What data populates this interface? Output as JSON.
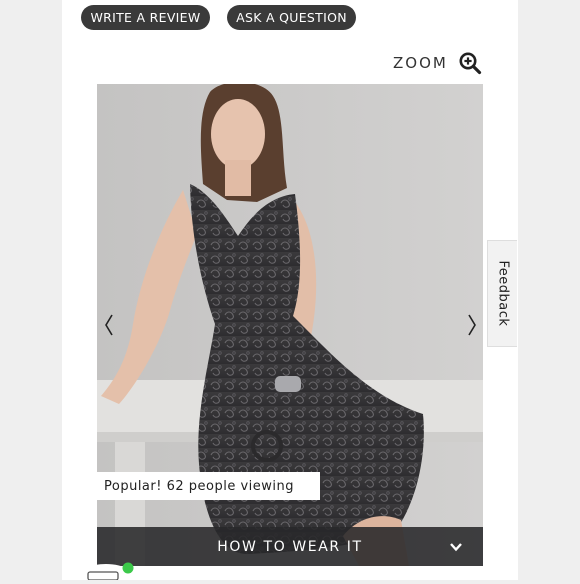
{
  "actions": {
    "write_review": "WRITE A REVIEW",
    "ask_question": "ASK A QUESTION"
  },
  "zoom": {
    "label": "ZOOM",
    "icon": "zoom-in-icon"
  },
  "product_image": {
    "description_icon": "product-photo"
  },
  "carousel": {
    "prev_icon": "chevron-left-icon",
    "next_icon": "chevron-right-icon"
  },
  "popularity": {
    "text": "Popular! 62 people viewing"
  },
  "how_to_wear": {
    "label": "HOW TO WEAR IT",
    "icon": "chevron-down-icon"
  },
  "feedback_tab": {
    "label": "Feedback"
  },
  "colors": {
    "pill_bg": "#3a3a3a",
    "overlay_bg": "#28282a",
    "status_dot": "#3cc94a"
  }
}
